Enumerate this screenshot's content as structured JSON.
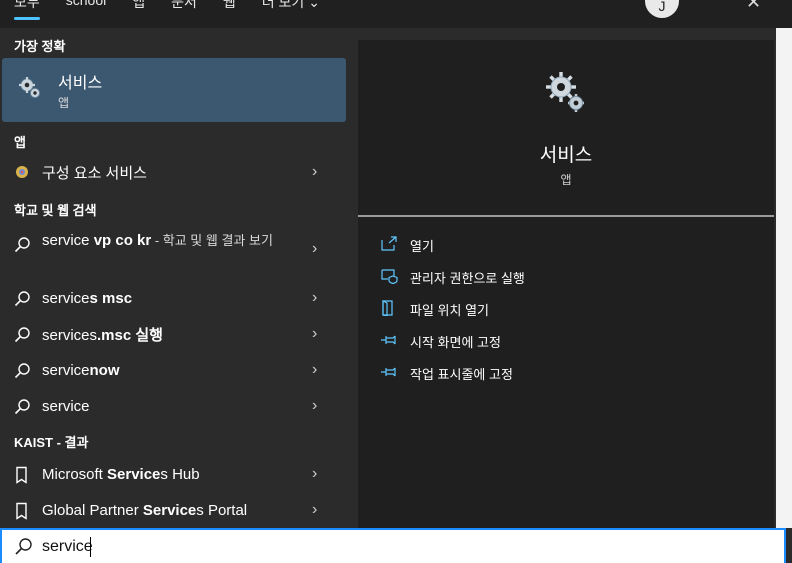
{
  "tabs": [
    "모두",
    "school",
    "앱",
    "문서",
    "웹",
    "더 보기"
  ],
  "avatar_initial": "J",
  "more_label": "···",
  "close_label": "✕",
  "sections": {
    "best_match": "가장 정확",
    "apps": "앱",
    "web": "학교 및 웹 검색",
    "kaist": "KAIST - 결과"
  },
  "best_match": {
    "title": "서비스",
    "subtitle": "앱"
  },
  "apps": [
    {
      "label": "구성 요소 서비스"
    }
  ],
  "web_results": [
    {
      "prefix": "service ",
      "bold": "vp co kr",
      "suffix": " - 학교 및 웹 결과 보기"
    },
    {
      "prefix": "service",
      "bold": "s msc",
      "suffix": ""
    },
    {
      "prefix": "services",
      "bold": ".msc 실행",
      "suffix": ""
    },
    {
      "prefix": "service",
      "bold": "now",
      "suffix": ""
    },
    {
      "prefix": "service",
      "bold": "",
      "suffix": ""
    }
  ],
  "kaist_results": [
    {
      "prefix": "Microsoft ",
      "bold": "Service",
      "suffix": "s Hub"
    },
    {
      "prefix": "Global Partner ",
      "bold": "Service",
      "suffix": "s Portal"
    }
  ],
  "detail": {
    "title": "서비스",
    "kind": "앱",
    "actions": [
      {
        "label": "열기",
        "icon": "open-icon"
      },
      {
        "label": "관리자 권한으로 실행",
        "icon": "shield-icon"
      },
      {
        "label": "파일 위치 열기",
        "icon": "file-location-icon"
      },
      {
        "label": "시작 화면에 고정",
        "icon": "pin-icon"
      },
      {
        "label": "작업 표시줄에 고정",
        "icon": "pin-icon"
      }
    ]
  },
  "search": {
    "value": "service"
  },
  "colors": {
    "accent": "#4cc2ff",
    "selected": "#3b5870",
    "search_border": "#1a8cff"
  }
}
